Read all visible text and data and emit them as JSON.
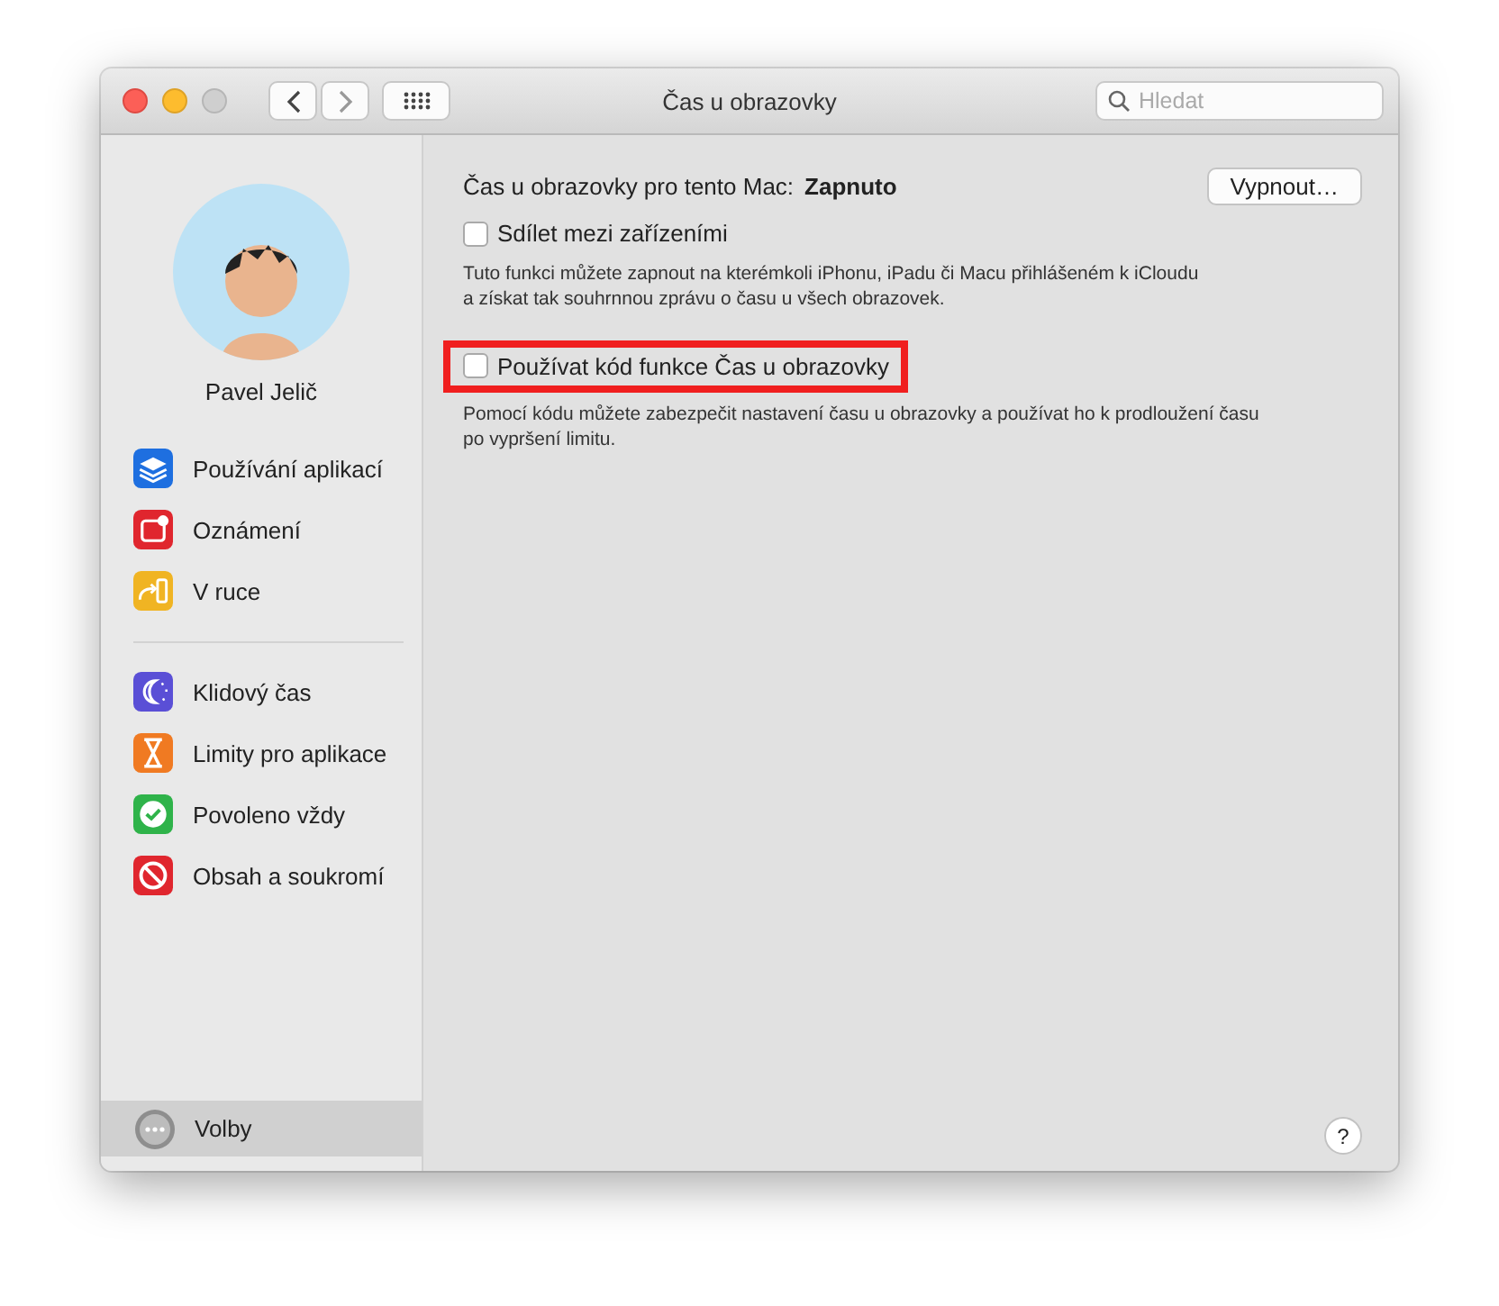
{
  "window": {
    "title": "Čas u obrazovky"
  },
  "toolbar": {
    "search": {
      "placeholder": "Hledat"
    }
  },
  "sidebar": {
    "user": {
      "name": "Pavel Jelič"
    },
    "groups": [
      [
        {
          "label": "Používání aplikací",
          "kind": "layers",
          "color": "#1e6fe0",
          "selected": false
        },
        {
          "label": "Oznámení",
          "kind": "notification",
          "color": "#e0262e",
          "selected": false
        },
        {
          "label": "V ruce",
          "kind": "handoff",
          "color": "#f0b423",
          "selected": false
        }
      ],
      [
        {
          "label": "Klidový čas",
          "kind": "downtime",
          "color": "#5a4fd6",
          "selected": false
        },
        {
          "label": "Limity pro aplikace",
          "kind": "hourglass",
          "color": "#f07a22",
          "selected": false
        },
        {
          "label": "Povoleno vždy",
          "kind": "check",
          "color": "#2fb34a",
          "selected": false
        },
        {
          "label": "Obsah a soukromí",
          "kind": "block",
          "color": "#e0262e",
          "selected": false
        }
      ]
    ],
    "footer_item": {
      "label": "Volby",
      "selected": true
    }
  },
  "main": {
    "status_label": "Čas u obrazovky pro tento Mac:",
    "status_value": "Zapnuto",
    "button": "Vypnout…",
    "options": [
      {
        "label": "Sdílet mezi zařízeními",
        "checked": false,
        "highlighted": false,
        "description": [
          "Tuto funkci můžete zapnout na kterémkoli iPhonu, iPadu či Macu přihlášeném k iCloudu",
          "a získat tak souhrnnou zprávu o času u všech obrazovek."
        ]
      },
      {
        "label": "Používat kód funkce Čas u obrazovky",
        "checked": false,
        "highlighted": true,
        "description": [
          "Pomocí kódu můžete zabezpečit nastavení času u obrazovky a používat ho k prodloužení času",
          "po vypršení limitu."
        ]
      }
    ],
    "help": "?"
  }
}
